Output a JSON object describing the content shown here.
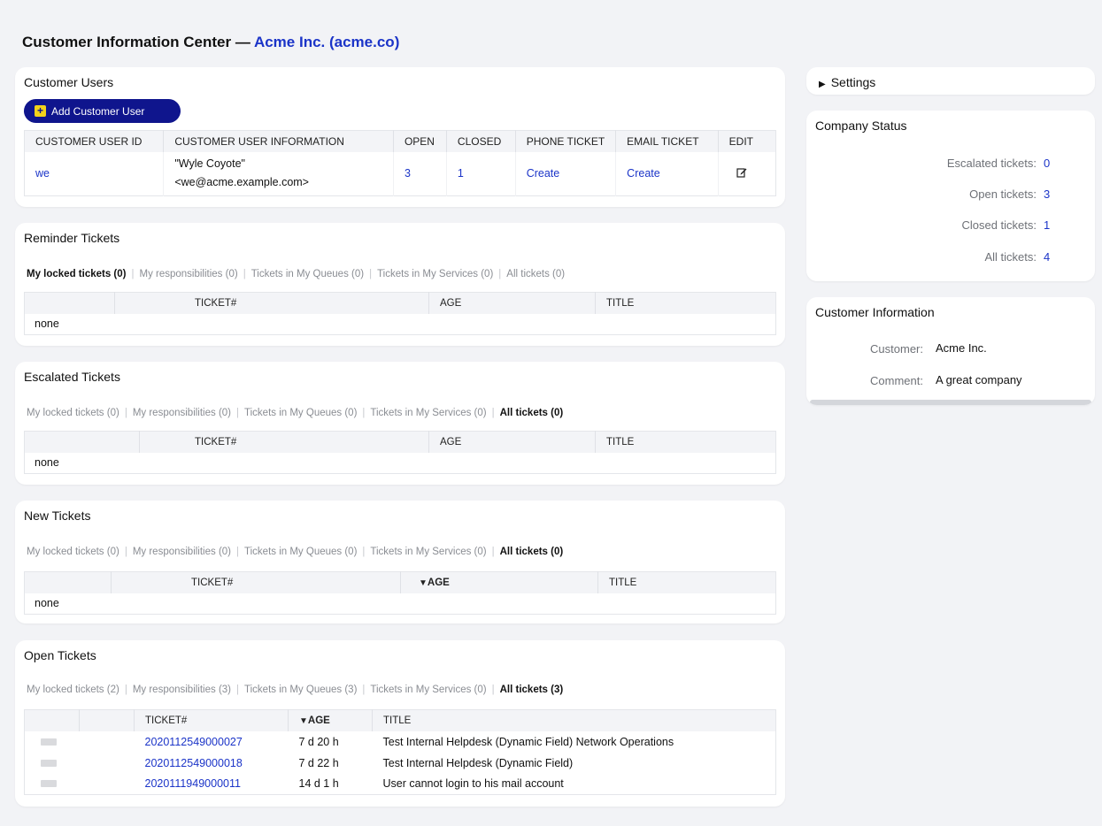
{
  "page": {
    "title": "Customer Information Center —",
    "company": "Acme Inc. (acme.co)"
  },
  "customer_users": {
    "title": "Customer Users",
    "add_button": "Add Customer User",
    "columns": [
      "CUSTOMER USER ID",
      "CUSTOMER USER INFORMATION",
      "OPEN",
      "CLOSED",
      "PHONE TICKET",
      "EMAIL TICKET",
      "EDIT"
    ],
    "rows": [
      {
        "id": "we",
        "info_line1": "\"Wyle Coyote\"",
        "info_line2": "<we@acme.example.com>",
        "open": "3",
        "closed": "1",
        "phone": "Create",
        "email": "Create",
        "edit_icon": "edit-icon"
      }
    ]
  },
  "tab_labels": {
    "sep": "|"
  },
  "reminder": {
    "title": "Reminder Tickets",
    "tabs": [
      "My locked tickets (0)",
      "My responsibilities (0)",
      "Tickets in My Queues (0)",
      "Tickets in My Services (0)",
      "All tickets (0)"
    ],
    "active_tab": 0,
    "columns": [
      "",
      "TICKET#",
      "AGE",
      "TITLE"
    ],
    "empty": "none"
  },
  "escalated": {
    "title": "Escalated Tickets",
    "tabs": [
      "My locked tickets (0)",
      "My responsibilities (0)",
      "Tickets in My Queues (0)",
      "Tickets in My Services (0)",
      "All tickets (0)"
    ],
    "active_tab": 4,
    "columns": [
      "",
      "TICKET#",
      "AGE",
      "TITLE"
    ],
    "empty": "none"
  },
  "new_tickets": {
    "title": "New Tickets",
    "tabs": [
      "My locked tickets (0)",
      "My responsibilities (0)",
      "Tickets in My Queues (0)",
      "Tickets in My Services (0)",
      "All tickets (0)"
    ],
    "active_tab": 4,
    "columns": [
      "",
      "TICKET#",
      "AGE",
      "TITLE"
    ],
    "sort_arrow": "▼",
    "empty": "none"
  },
  "open_tickets": {
    "title": "Open Tickets",
    "tabs": [
      "My locked tickets (2)",
      "My responsibilities (3)",
      "Tickets in My Queues (3)",
      "Tickets in My Services (0)",
      "All tickets (3)"
    ],
    "active_tab": 4,
    "columns": [
      "",
      "",
      "TICKET#",
      "AGE",
      "TITLE"
    ],
    "sort_arrow": "▼",
    "rows": [
      {
        "ticket": "2020112549000027",
        "age": "7 d 20 h",
        "title": "Test Internal Helpdesk (Dynamic Field) Network Operations"
      },
      {
        "ticket": "2020112549000018",
        "age": "7 d 22 h",
        "title": "Test Internal Helpdesk (Dynamic Field)"
      },
      {
        "ticket": "2020111949000011",
        "age": "14 d 1 h",
        "title": "User cannot login to his mail account"
      }
    ]
  },
  "settings": {
    "title": "Settings"
  },
  "company_status": {
    "title": "Company Status",
    "items": [
      {
        "label": "Escalated tickets:",
        "value": "0"
      },
      {
        "label": "Open tickets:",
        "value": "3"
      },
      {
        "label": "Closed tickets:",
        "value": "1"
      },
      {
        "label": "All tickets:",
        "value": "4"
      }
    ]
  },
  "customer_information": {
    "title": "Customer Information",
    "customer_label": "Customer:",
    "customer_value": "Acme Inc.",
    "comment_label": "Comment:",
    "comment_value": "A great company"
  },
  "colors": {
    "accent": "#1b34c8",
    "button": "#0f158d",
    "plus_icon": "#f3d21b",
    "background": "#f2f3f6"
  }
}
